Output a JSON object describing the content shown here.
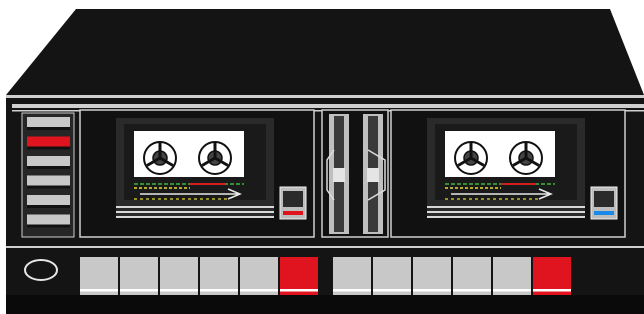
{
  "deck": {
    "colors": {
      "body": "#141414",
      "body_light": "#262626",
      "trim": "#cfcfcf",
      "button_gray": "#c8c8c8",
      "button_red": "#e0141e",
      "indicator_blue": "#1a8ae6",
      "indicator_red": "#e0141e",
      "tape_line_green": "#3cb43c",
      "tape_line_yellow": "#e6dc32",
      "tape_line_red": "#d21e1e"
    },
    "left_panel": {
      "buttons": [
        {
          "name": "panel-button-1",
          "color": "gray"
        },
        {
          "name": "panel-button-2",
          "color": "red"
        },
        {
          "name": "panel-button-3",
          "color": "gray"
        },
        {
          "name": "panel-button-4",
          "color": "gray"
        },
        {
          "name": "panel-button-5",
          "color": "gray"
        },
        {
          "name": "panel-button-6",
          "color": "gray"
        }
      ]
    },
    "decks": [
      {
        "name": "deck-a",
        "indicator": "red"
      },
      {
        "name": "deck-b",
        "indicator": "blue"
      }
    ],
    "transport_left": [
      "gray",
      "gray",
      "gray",
      "gray",
      "gray",
      "red"
    ],
    "transport_right": [
      "gray",
      "gray",
      "gray",
      "gray",
      "gray",
      "red"
    ],
    "power_button_icon": "oval-power-icon"
  }
}
